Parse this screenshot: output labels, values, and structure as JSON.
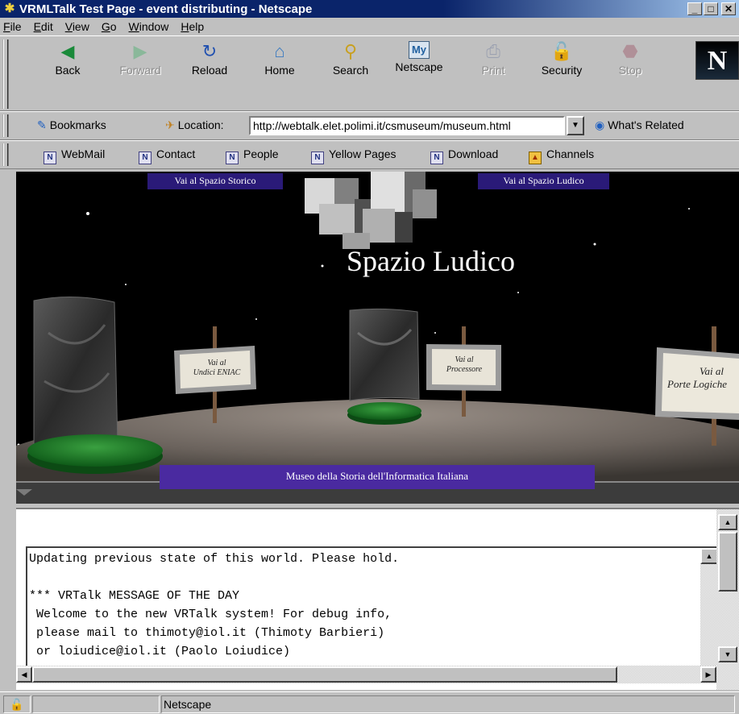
{
  "window": {
    "title": "VRMLTalk Test Page - event distributing - Netscape"
  },
  "menu": [
    "File",
    "Edit",
    "View",
    "Go",
    "Window",
    "Help"
  ],
  "nav": {
    "buttons": [
      {
        "label": "Back",
        "enabled": true,
        "icon": "back-arrow-icon"
      },
      {
        "label": "Forward",
        "enabled": false,
        "icon": "forward-arrow-icon"
      },
      {
        "label": "Reload",
        "enabled": true,
        "icon": "reload-icon"
      },
      {
        "label": "Home",
        "enabled": true,
        "icon": "home-icon"
      },
      {
        "label": "Search",
        "enabled": true,
        "icon": "search-icon"
      },
      {
        "label": "Netscape",
        "enabled": true,
        "icon": "netscape-icon"
      },
      {
        "label": "Print",
        "enabled": false,
        "icon": "print-icon"
      },
      {
        "label": "Security",
        "enabled": true,
        "icon": "security-lock-icon"
      },
      {
        "label": "Stop",
        "enabled": false,
        "icon": "stop-icon"
      }
    ]
  },
  "location": {
    "bookmarks_label": "Bookmarks",
    "label": "Location:",
    "url": "http://webtalk.elet.polimi.it/csmuseum/museum.html",
    "related_label": "What's Related"
  },
  "personal": [
    "WebMail",
    "Contact",
    "People",
    "Yellow Pages",
    "Download",
    "Channels"
  ],
  "scene": {
    "link_left": "Vai al Spazio Storico",
    "link_right": "Vai al Spazio Ludico",
    "title": "Spazio Ludico",
    "sign1_line1": "Vai al",
    "sign1_line2": "Undici ENIAC",
    "sign2_line1": "Vai al",
    "sign2_line2": "Processore",
    "sign3_line1": "Vai al",
    "sign3_line2": "Porte Logiche",
    "banner": "Museo della Storia dell'Informatica Italiana"
  },
  "console": {
    "text": "Updating previous state of this world. Please hold.\n\n*** VRTalk MESSAGE OF THE DAY\n Welcome to the new VRTalk system! For debug info,\n please mail to thimoty@iol.it (Thimoty Barbieri)\n or loiudice@iol.it (Paolo Loiudice)"
  },
  "status": {
    "text": "Netscape"
  },
  "colors": {
    "titlebar": "#0a246a",
    "chrome": "#c0c0c0",
    "scene_banner": "#4a2aa0"
  }
}
